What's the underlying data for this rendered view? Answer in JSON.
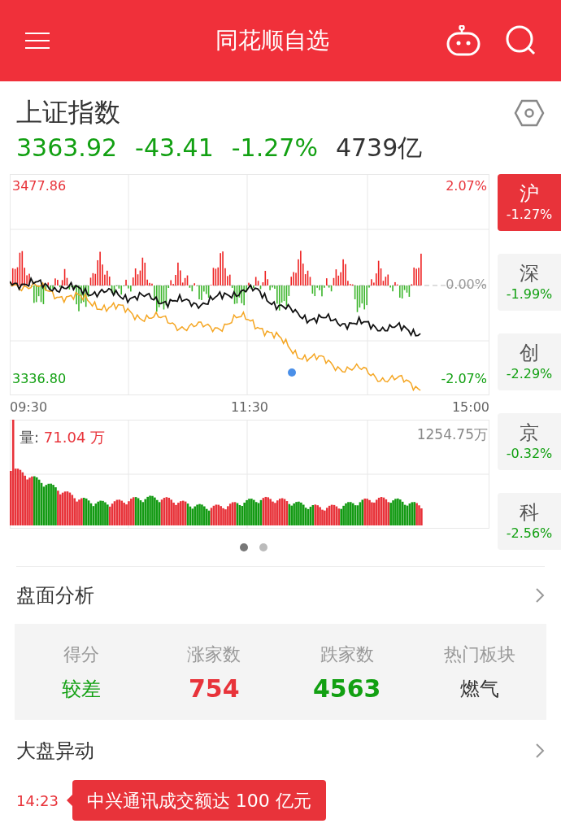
{
  "header": {
    "title": "同花顺自选"
  },
  "index": {
    "name": "上证指数",
    "price": "3363.92",
    "change": "-43.41",
    "change_pct": "-1.27%",
    "turnover": "4739亿"
  },
  "price_chart": {
    "max_price": "3477.86",
    "min_price": "3336.80",
    "max_pct": "2.07%",
    "min_pct": "-2.07%",
    "zero_pct": "0.00%",
    "times": [
      "09:30",
      "11:30",
      "15:00"
    ]
  },
  "volume_chart": {
    "label": "量: ",
    "value": "71.04 万",
    "max": "1254.75万"
  },
  "pages": [
    {
      "selected": true
    },
    {
      "selected": false
    }
  ],
  "markets": [
    {
      "name": "沪",
      "change": "-1.27%",
      "selected": true
    },
    {
      "name": "深",
      "change": "-1.99%",
      "selected": false
    },
    {
      "name": "创",
      "change": "-2.29%",
      "selected": false
    },
    {
      "name": "京",
      "change": "-0.32%",
      "selected": false
    },
    {
      "name": "科",
      "change": "-2.56%",
      "selected": false
    }
  ],
  "analysis": {
    "title": "盘面分析",
    "stats": [
      {
        "label": "得分",
        "value": "较差",
        "color": "#12a012",
        "kind": "text"
      },
      {
        "label": "涨家数",
        "value": "754",
        "color": "#e8333a",
        "kind": "number"
      },
      {
        "label": "跌家数",
        "value": "4563",
        "color": "#12a012",
        "kind": "number"
      },
      {
        "label": "热门板块",
        "value": "燃气",
        "color": "#333333",
        "kind": "text"
      }
    ]
  },
  "movements": {
    "title": "大盘异动",
    "events": [
      {
        "time": "14:23",
        "text": "中兴通讯成交额达 100 亿元"
      }
    ]
  }
}
